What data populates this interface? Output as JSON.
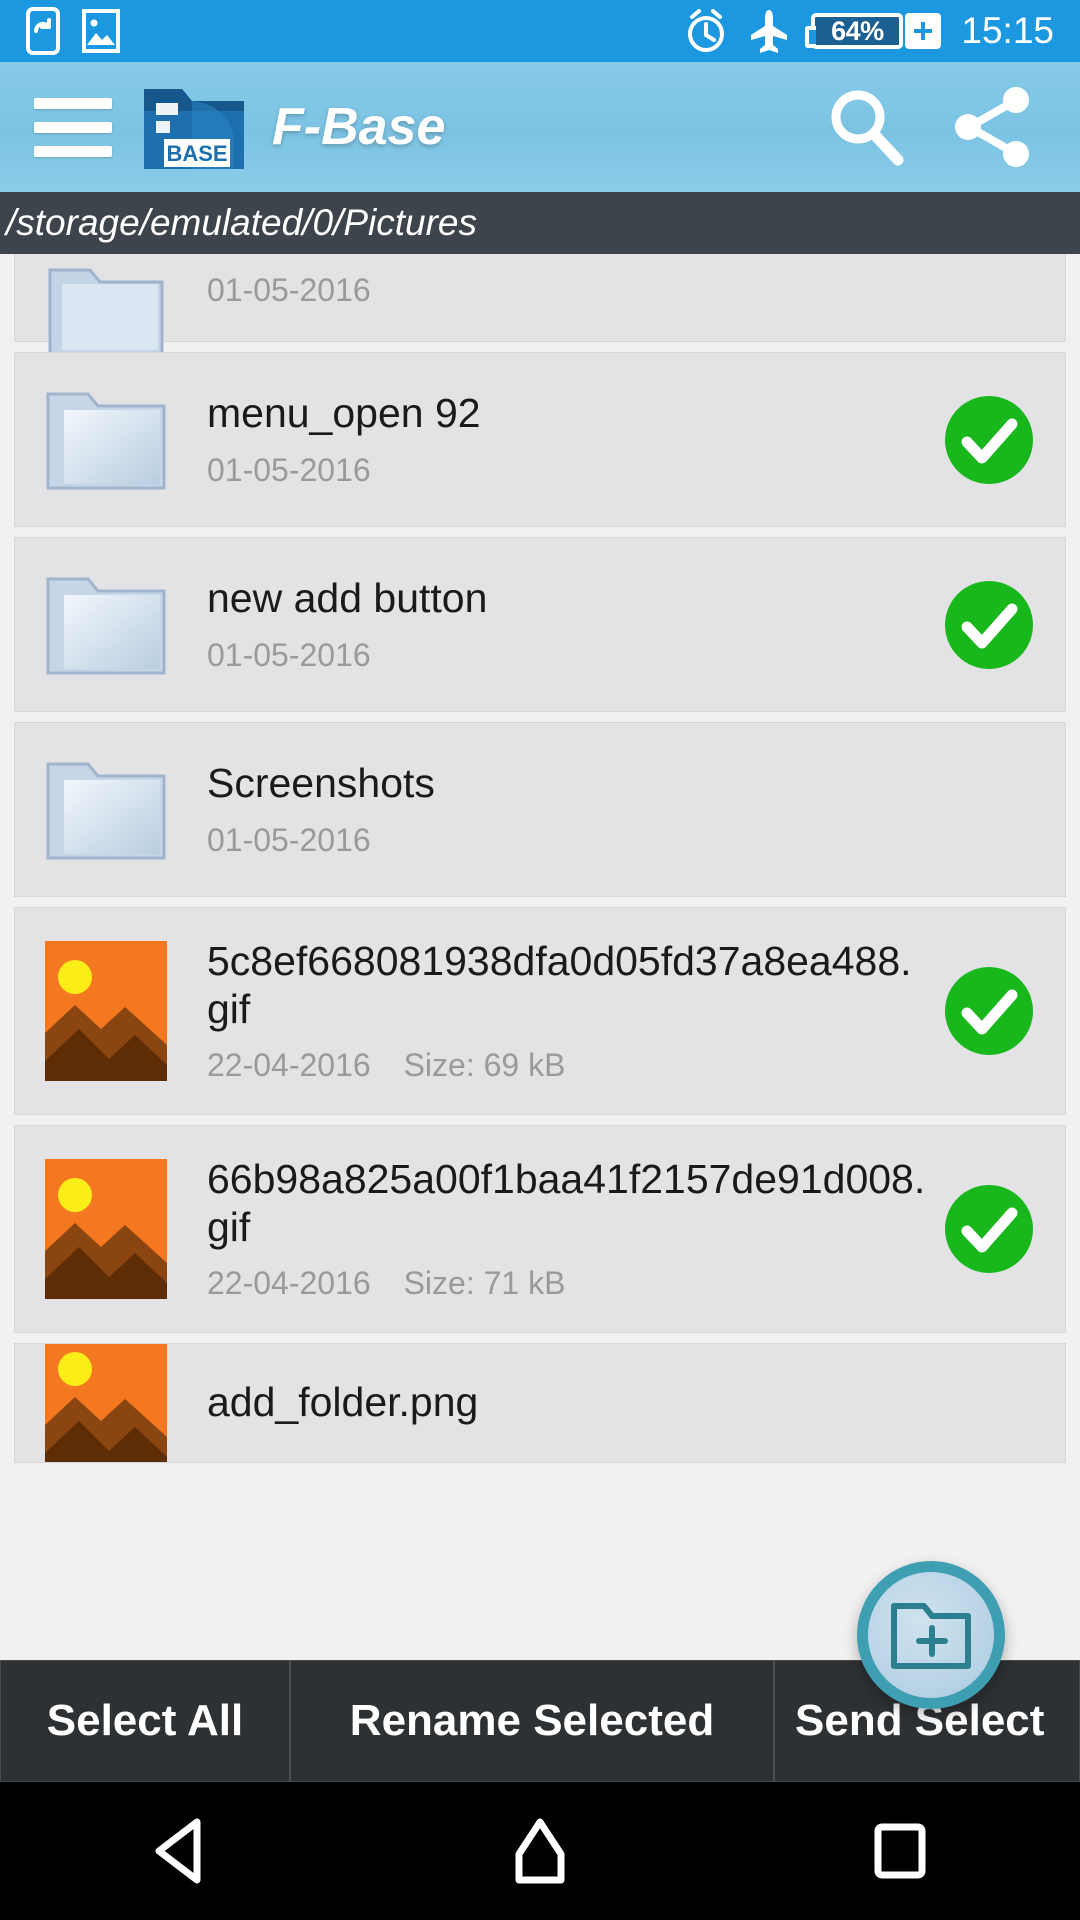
{
  "statusbar": {
    "left_icons": [
      "screen-rotate-icon",
      "image-icon"
    ],
    "right_icons": [
      "alarm-icon",
      "airplane-mode-icon"
    ],
    "battery_percent": "64%",
    "battery_state": "charging",
    "time": "15:15",
    "bg_color": "#1c98e0"
  },
  "appbar": {
    "menu_icon": "hamburger-menu-icon",
    "logo_text": "BASE",
    "title": "F-Base",
    "search_icon": "search-icon",
    "share_icon": "share-icon",
    "bg_color": "#7cc3e3"
  },
  "pathbar": {
    "path": "/storage/emulated/0/Pictures",
    "bg_color": "#3d444b"
  },
  "list": {
    "rows": [
      {
        "name": "",
        "date": "01-05-2016",
        "size": "",
        "type": "folder",
        "selected": false,
        "clipped": true
      },
      {
        "name": "menu_open 92",
        "date": "01-05-2016",
        "size": "",
        "type": "folder",
        "selected": true
      },
      {
        "name": "new add button",
        "date": "01-05-2016",
        "size": "",
        "type": "folder",
        "selected": true
      },
      {
        "name": "Screenshots",
        "date": "01-05-2016",
        "size": "",
        "type": "folder",
        "selected": false
      },
      {
        "name": "5c8ef668081938dfa0d05fd37a8ea488.gif",
        "date": "22-04-2016",
        "size": "Size: 69 kB",
        "type": "image",
        "selected": true
      },
      {
        "name": "66b98a825a00f1baa41f2157de91d008.gif",
        "date": "22-04-2016",
        "size": "Size: 71 kB",
        "type": "image",
        "selected": true
      },
      {
        "name": "add_folder.png",
        "date": "",
        "size": "",
        "type": "image",
        "selected": false,
        "clipped": true
      }
    ]
  },
  "fab": {
    "icon": "add-folder-icon",
    "ring_color": "#3e9fb2",
    "fill_color": "#b9d4e6"
  },
  "actionbar": {
    "buttons": [
      {
        "label": "Select All"
      },
      {
        "label": "Rename Selected"
      },
      {
        "label": "Send Select"
      }
    ],
    "bg_color": "#2e3134"
  },
  "navbar": {
    "back_icon": "back-triangle-icon",
    "home_icon": "home-icon",
    "recents_icon": "recents-square-icon"
  }
}
